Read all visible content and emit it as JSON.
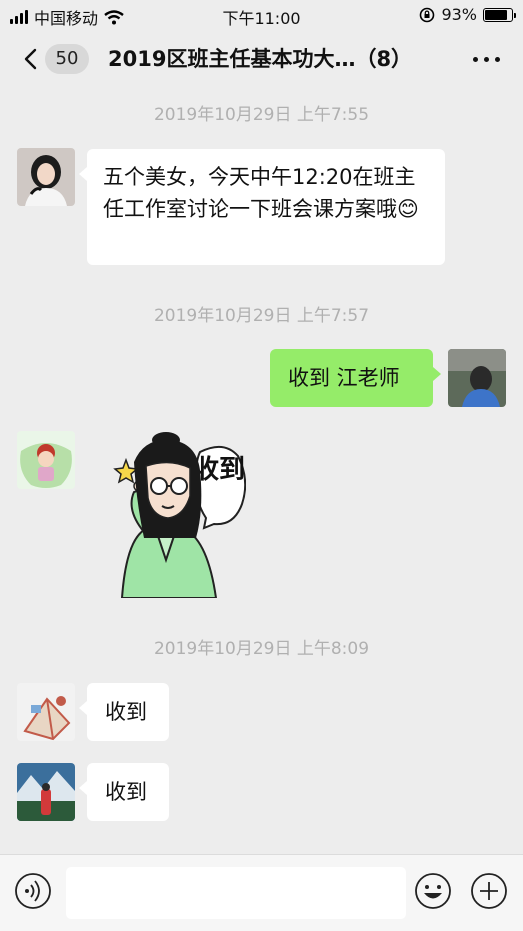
{
  "status_bar": {
    "carrier": "中国移动",
    "time": "下午11:00",
    "battery_text": "93%",
    "battery_level": 0.93
  },
  "nav": {
    "unread_count": "50",
    "title": "2019区班主任基本功大…（8）"
  },
  "messages": {
    "ts1": "2019年10月29日 上午7:55",
    "msg1_text": "五个美女，今天中午12:20在班主任工作室讨论一下班会课方案哦😊",
    "ts2": "2019年10月29日 上午7:57",
    "msg2_text": "收到 江老师",
    "sticker_text": "收到",
    "ts3": "2019年10月29日 上午8:09",
    "msg4_text": "收到",
    "msg5_text": "收到"
  },
  "input": {
    "placeholder": ""
  },
  "colors": {
    "background": "#ededed",
    "outgoing_bubble": "#95ec69",
    "incoming_bubble": "#ffffff",
    "timestamp": "#b0b0b0"
  }
}
